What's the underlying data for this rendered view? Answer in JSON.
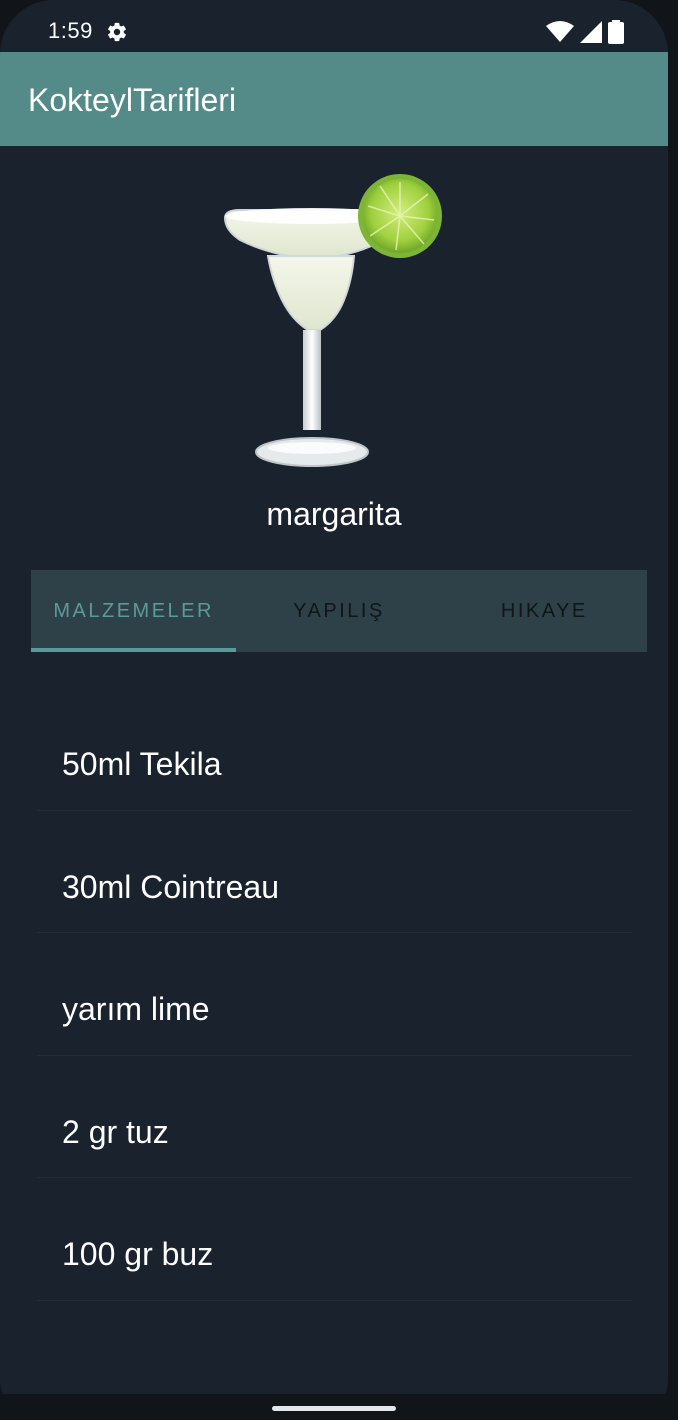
{
  "status_bar": {
    "time": "1:59",
    "icons": [
      "gear-icon",
      "wifi-icon",
      "signal-icon",
      "battery-icon"
    ]
  },
  "app_bar": {
    "title": "KokteylTarifleri",
    "color": "#548b89"
  },
  "drink": {
    "image_icon": "margarita-glass-with-lime",
    "name": "margarita"
  },
  "tabs": [
    {
      "label": "MALZEMELER",
      "selected": true
    },
    {
      "label": "YAPILIŞ",
      "selected": false
    },
    {
      "label": "HIKAYE",
      "selected": false
    }
  ],
  "ingredients": [
    "50ml Tekila",
    "30ml Cointreau",
    "yarım lime",
    "2 gr tuz",
    "100 gr buz"
  ],
  "colors": {
    "background": "#1a222e",
    "tab_bar": "#2f4148",
    "accent": "#5a9a98"
  }
}
